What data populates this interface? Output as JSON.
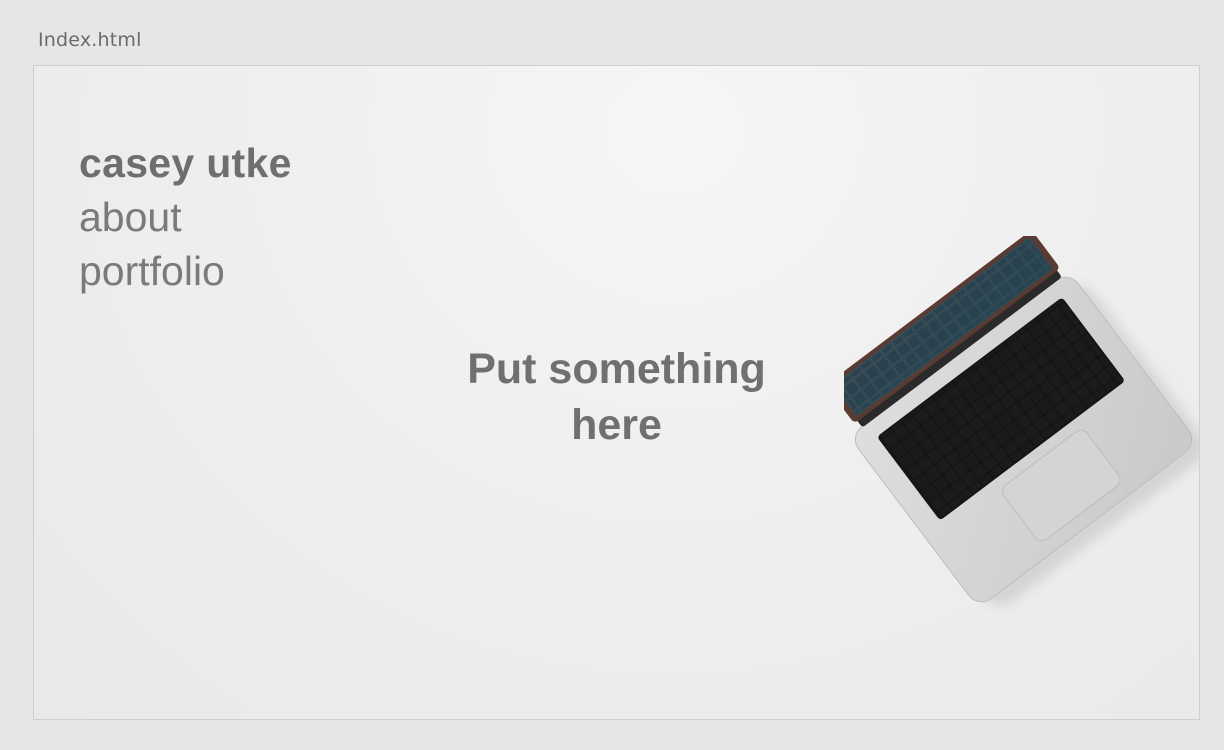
{
  "file": {
    "name": "Index.html"
  },
  "site": {
    "name": "casey utke",
    "nav": [
      {
        "label": "about"
      },
      {
        "label": "portfolio"
      }
    ]
  },
  "hero": {
    "text": "Put something\nhere"
  },
  "image": {
    "icon": "laptop-icon"
  }
}
